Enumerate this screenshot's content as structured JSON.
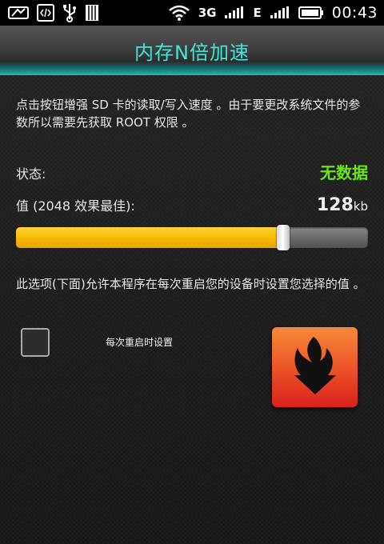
{
  "status_bar": {
    "time": "00:43",
    "network_3g": "3G",
    "network_e": "E",
    "icons": [
      "screen-icon",
      "code-icon",
      "usb-icon",
      "sd-card-icon",
      "wifi-icon",
      "signal-icon",
      "signal-icon",
      "battery-icon"
    ]
  },
  "header": {
    "title": "内存N倍加速"
  },
  "main": {
    "description": "点击按钮增强 SD 卡的读取/写入速度 。由于要更改系统文件的参数所以需要先获取 ROOT 权限 。",
    "status_label": "状态:",
    "status_value": "无数据",
    "value_label": "值 (2048 效果最佳):",
    "value_number": "128",
    "value_unit": "kb",
    "slider_fraction": 0.76,
    "option_description": "此选项(下面)允许本程序在每次重启您的设备时设置您选择的值 。",
    "checkbox_label": "每次重启时设置",
    "checkbox_checked": false,
    "boost_button_icon": "flame-arrow-icon"
  },
  "colors": {
    "title": "#3fe6d8",
    "status_value": "#6be41a",
    "slider_fill": "#f6b900",
    "button": "#e8452a"
  }
}
